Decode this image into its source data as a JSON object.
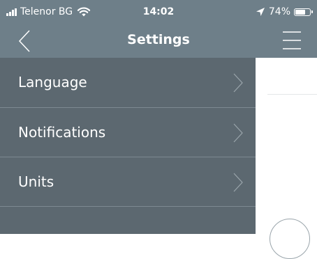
{
  "status_bar": {
    "carrier": "Telenor BG",
    "time": "14:02",
    "battery_percent": "74%",
    "battery_level": 0.74,
    "icons": [
      "signal-bars-icon",
      "wifi-icon",
      "location-arrow-icon",
      "battery-icon"
    ]
  },
  "nav": {
    "title": "Settings",
    "back_icon": "chevron-left-icon",
    "menu_icon": "hamburger-menu-icon"
  },
  "settings": {
    "items": [
      {
        "label": "Language"
      },
      {
        "label": "Notifications"
      },
      {
        "label": "Units"
      }
    ]
  },
  "colors": {
    "header_background": "#6e7f89",
    "list_background": "#5c6870",
    "list_divider": "#7d8a92",
    "text": "#ffffff",
    "page_background": "#ffffff"
  }
}
